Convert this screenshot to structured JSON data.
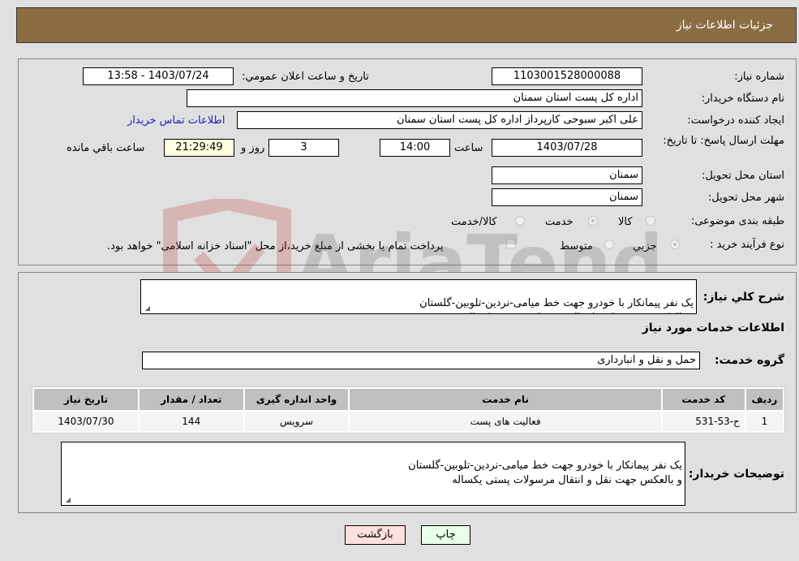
{
  "header": {
    "title": "جزئيات اطلاعات نياز"
  },
  "info": {
    "need_number_label": "شماره نياز:",
    "need_number": "1103001528000088",
    "announce_label": "تاريخ و ساعت اعلان عمومي:",
    "announce_value": "1403/07/24 - 13:58",
    "buyer_org_label": "نام دستگاه خريدار:",
    "buyer_org": "اداره کل پست استان سمنان",
    "creator_label": "ايجاد کننده درخواست:",
    "creator": "علی اکبر سبوحی کارپرداز اداره کل پست استان سمنان",
    "contact_link": "اطلاعات تماس خريدار",
    "deadline_label": "مهلت ارسال پاسخ: تا تاريخ:",
    "deadline_date": "1403/07/28",
    "time_label": "ساعت",
    "deadline_time": "14:00",
    "days_value": "3",
    "days_label": "روز و",
    "remaining_time": "21:29:49",
    "remaining_label": "ساعت باقي مانده",
    "province_label": "استان محل تحويل:",
    "province": "سمنان",
    "city_label": "شهر محل تحويل:",
    "city": "سمنان",
    "category_label": "طبقه بندی موضوعی:",
    "category_options": [
      {
        "label": "کالا",
        "selected": false
      },
      {
        "label": "خدمت",
        "selected": true
      },
      {
        "label": "کالا/خدمت",
        "selected": false
      }
    ],
    "process_label": "نوع فرآيند خريد :",
    "process_options": [
      {
        "label": "جزيي",
        "selected": true
      },
      {
        "label": "متوسط",
        "selected": false
      }
    ],
    "treasury_note": "پرداخت تمام يا بخشی از مبلغ خريد،از محل \"اسناد خزانه اسلامی\" خواهد بود.",
    "treasury_checked": false
  },
  "details": {
    "summary_label": "شرح کلي نياز:",
    "summary": "يک نفر پيمانکار با خودرو جهت خط ميامی-نردين-تلوبين-گلستان\nو بالعکس جهت نقل و انتقال مرسولات پستی يکساله",
    "services_heading": "اطلاعات خدمات مورد نياز",
    "service_group_label": "گروه خدمت:",
    "service_group": "حمل و نقل و انبارداری",
    "table": {
      "headers": [
        "رديف",
        "کد خدمت",
        "نام خدمت",
        "واحد اندازه گيری",
        "تعداد / مقدار",
        "تاريخ نياز"
      ],
      "rows": [
        [
          "1",
          "ح-53-531",
          "فعاليت های پست",
          "سرويس",
          "144",
          "1403/07/30"
        ]
      ]
    },
    "buyer_notes_label": "توضيحات خريدار:",
    "buyer_notes": "يک نفر پيمانکار با خودرو جهت خط ميامی-نردين-تلوبين-گلستان\nو بالعکس جهت نقل و انتقال مرسولات پستی يکساله"
  },
  "buttons": {
    "print": "چاپ",
    "back": "بازگشت"
  },
  "watermark": {
    "text": "AriaTender.neT"
  },
  "colors": {
    "header_bg": "#8b6d44",
    "print_bg": "#e8ffe8",
    "back_bg": "#ffe0e0",
    "link": "#2020c0"
  }
}
